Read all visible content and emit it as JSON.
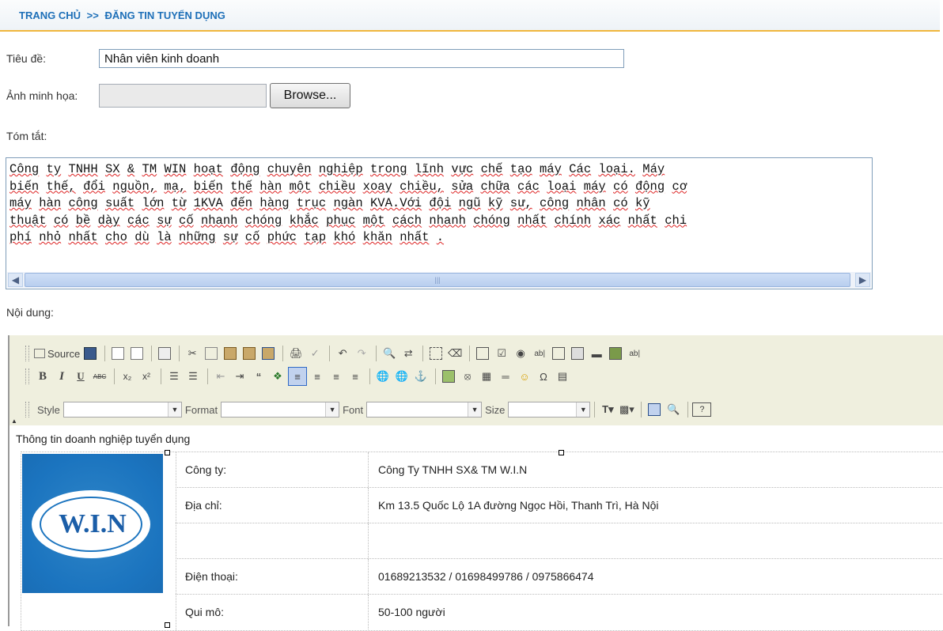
{
  "breadcrumb": {
    "home": "TRANG CHỦ",
    "sep": ">>",
    "current": "ĐĂNG TIN TUYỂN DỤNG"
  },
  "form": {
    "title_label": "Tiêu đề:",
    "title_value": "Nhân viên kinh doanh",
    "image_label": "Ảnh minh họa:",
    "browse_label": "Browse...",
    "summary_label": "Tóm tắt:",
    "summary_lines": [
      "Công ty TNHH SX & TM WIN hoạt động chuyên nghiệp trong lĩnh vực chế tạo máy Các loại. Máy",
      "biến thế, đổi nguồn, mạ, biến thế hàn một chiều xoay chiều, sửa chữa các loại máy có động cơ",
      "máy hàn công suất lớn từ 1KVA đến hàng trục ngàn KVA.Với đội ngũ kỹ sư, công nhân có kỹ",
      "thuật có bề dày các sự cố nhanh chóng khắc phục một cách nhanh chóng nhất chính xác nhất chi",
      "phí nhỏ nhất cho dù là những sự cố phức tạp khó khăn nhất ."
    ],
    "content_label": "Nội dung:"
  },
  "editor": {
    "source_label": "Source",
    "style_label": "Style",
    "format_label": "Format",
    "font_label": "Font",
    "size_label": "Size",
    "bold": "B",
    "italic": "I",
    "underline": "U",
    "strike": "ABC",
    "caption": "Thông tin doanh nghiệp tuyển dụng",
    "logo_text": "W.I.N",
    "rows": [
      {
        "key": "Công ty:",
        "value": "Công Ty TNHH SX& TM W.I.N"
      },
      {
        "key": "Địa chỉ:",
        "value": "Km 13.5 Quốc Lộ 1A đường Ngọc Hồi, Thanh Trì, Hà Nội"
      },
      {
        "key": "",
        "value": ""
      },
      {
        "key": "Điện thoại:",
        "value": "01689213532 / 01698499786 / 0975866474"
      },
      {
        "key": "Qui mô:",
        "value": "50-100 người"
      }
    ]
  },
  "colors": {
    "accent": "#1d6fb8",
    "header_border": "#f0b63c",
    "toolbar_bg": "#efefde"
  }
}
